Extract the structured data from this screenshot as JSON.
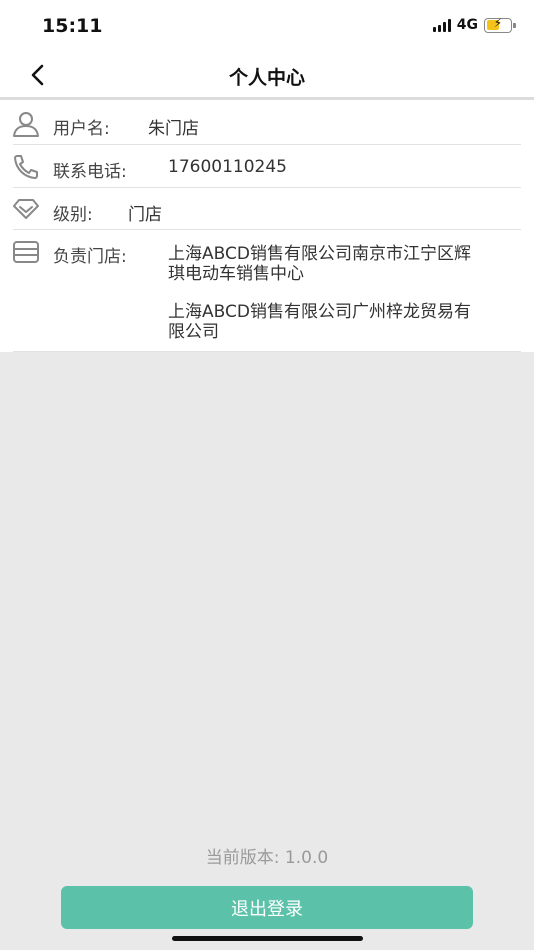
{
  "status_bar": {
    "time": "15:11",
    "network": "4G",
    "icons": [
      "signal-icon",
      "battery-charging-icon"
    ]
  },
  "header": {
    "title": "个人中心",
    "back_icon": "chevron-left-icon"
  },
  "profile": {
    "username_label": "用户名:",
    "username_value": "朱门店",
    "phone_label": "联系电话:",
    "phone_value": "17600110245",
    "level_label": "级别:",
    "level_value": "门店",
    "stores_label": "负责门店:",
    "stores": [
      {
        "line1": "上海ABCD销售有限公司南京市江宁区辉",
        "line2": "琪电动车销售中心"
      },
      {
        "line1": "上海ABCD销售有限公司广州梓龙贸易有",
        "line2": "限公司"
      }
    ],
    "icons": {
      "username": "user-icon",
      "phone": "phone-icon",
      "level": "diamond-icon",
      "stores": "store-icon"
    }
  },
  "footer": {
    "version_text": "当前版本: 1.0.0",
    "logout_label": "退出登录"
  },
  "colors": {
    "accent": "#5bc2a9",
    "background": "#e9e9e9",
    "panel": "#ffffff",
    "icon_gray": "#888888"
  }
}
